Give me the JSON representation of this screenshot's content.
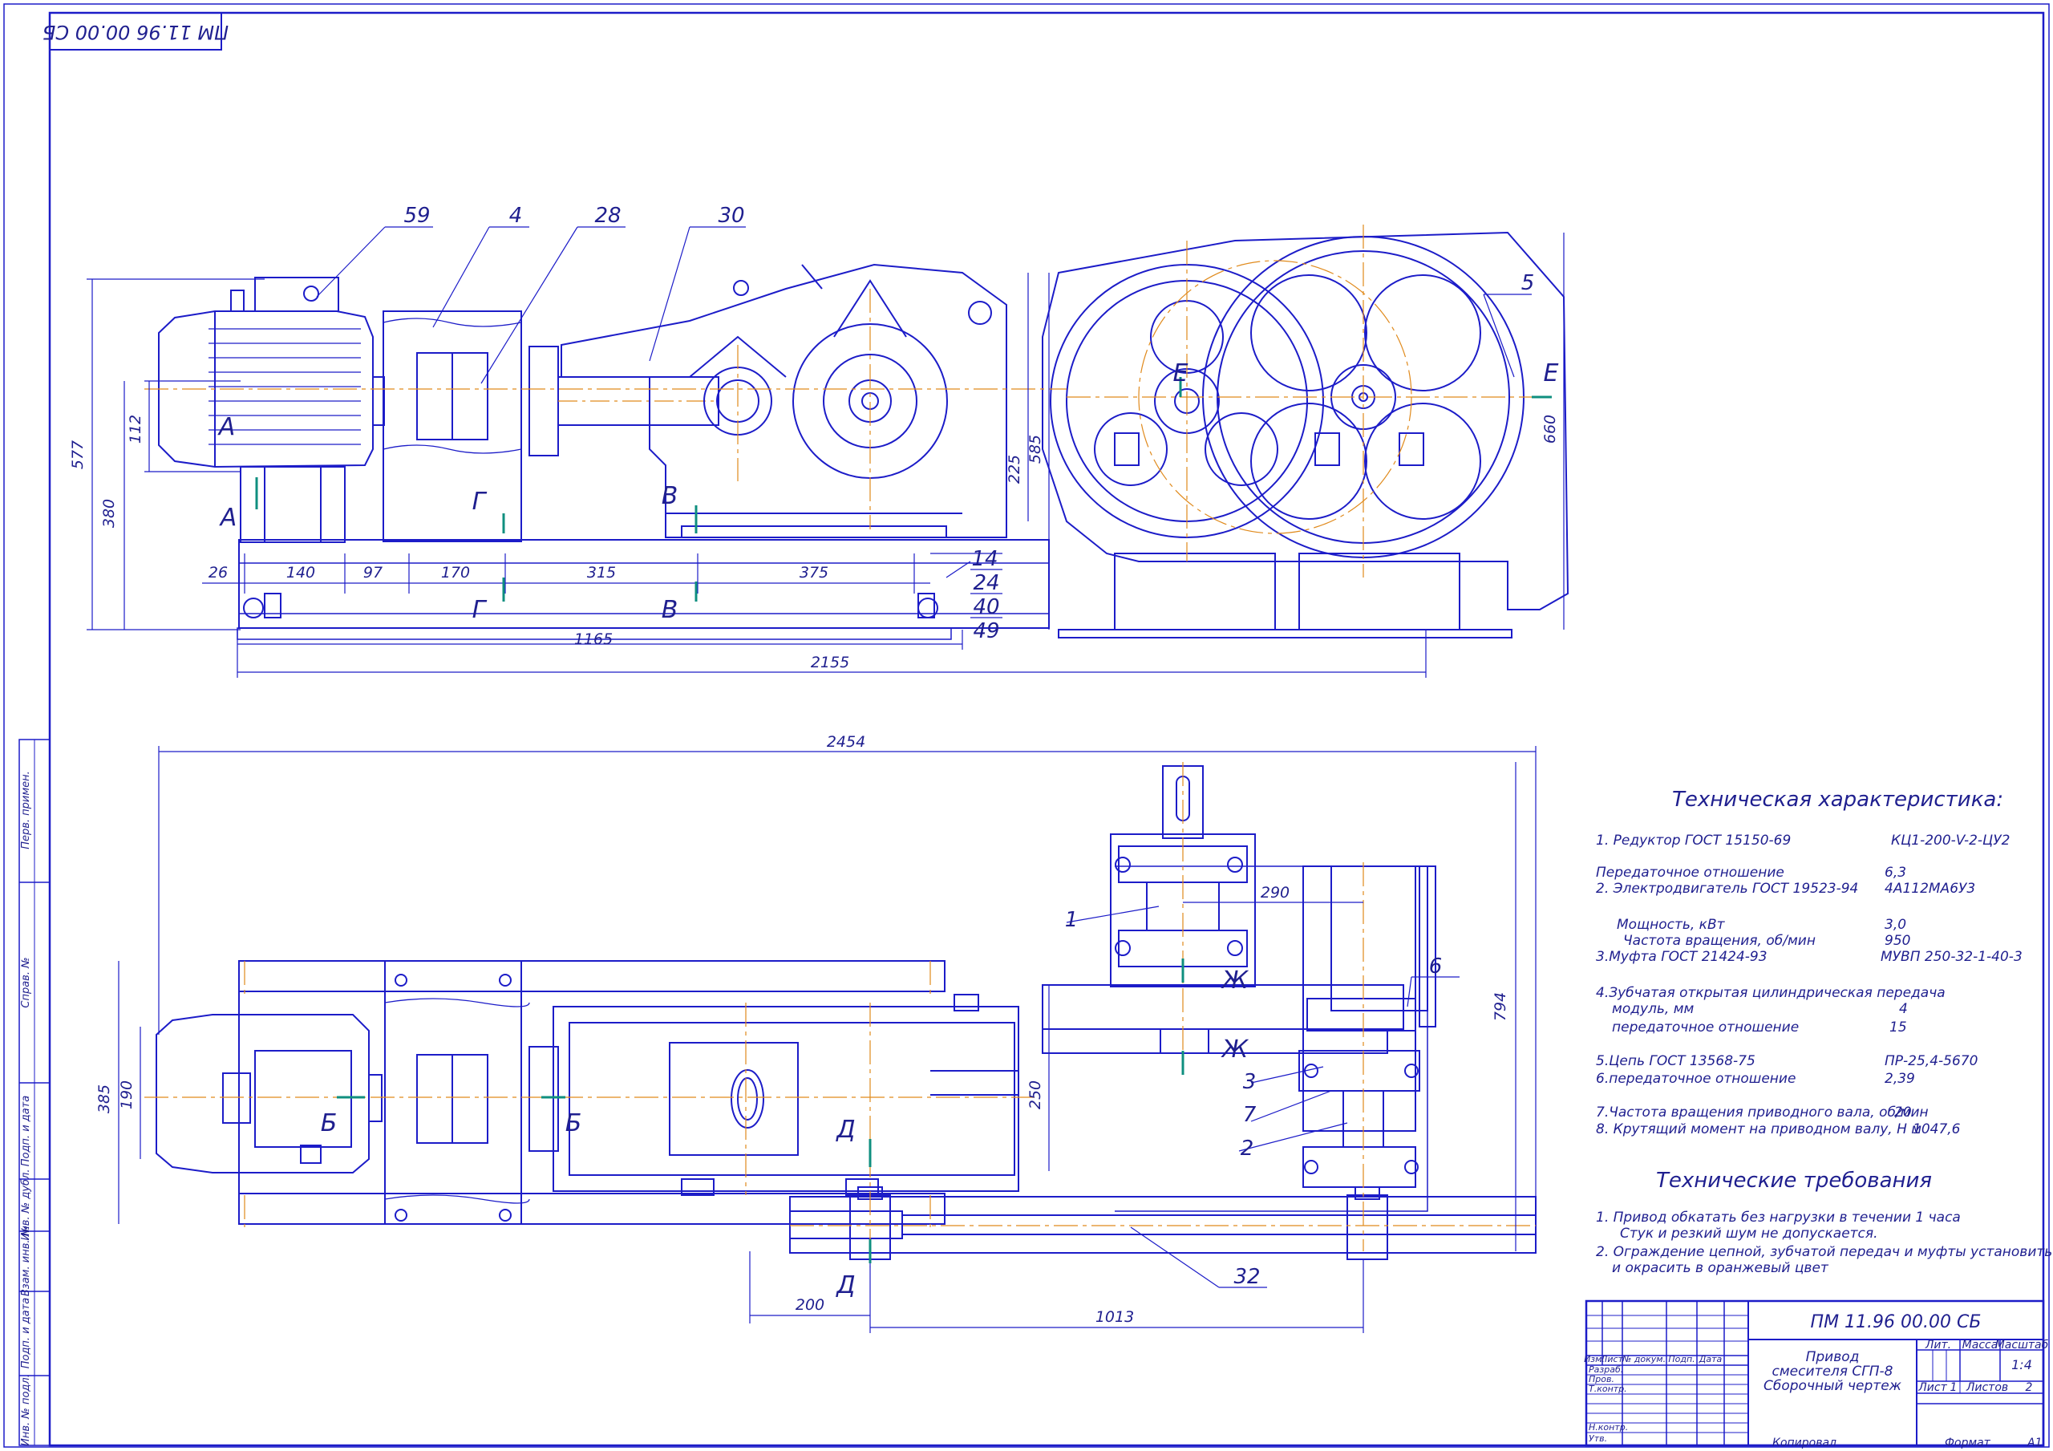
{
  "drawing": {
    "doc_code": "ПМ 11.96 00.00 СБ",
    "stamp_code_rotated": "ПМ 11.96 00.00 СБ",
    "title_lines": [
      "Привод",
      "смесителя СГП-8",
      "Сборочный чертеж"
    ],
    "litera_label": "Лит.",
    "mass_label": "Масса",
    "scale_label": "Масштаб",
    "scale_value": "1:4",
    "sheet_label": "Лист",
    "sheet_value": "1",
    "sheets_label": "Листов",
    "sheets_value": "2",
    "copied_label": "Копировал",
    "format_label": "Формат",
    "format_value": "А1",
    "change_cols": [
      "Изм.",
      "Лист",
      "№ докум.",
      "Подп.",
      "Дата"
    ],
    "roles": [
      "Разраб.",
      "Пров.",
      "Т.контр.",
      "",
      "Н.контр.",
      "Утв."
    ]
  },
  "side_stamp": [
    "Перв. примен.",
    "Справ. №",
    "Подп. и дата",
    "Инв. № дубл.",
    "Взам. инв. №",
    "Подп. и дата",
    "Инв. № подл."
  ],
  "parts": {
    "p59": "59",
    "p4": "4",
    "p28": "28",
    "p30": "30",
    "p5": "5",
    "p14": "14",
    "p24": "24",
    "p40": "40",
    "p49": "49",
    "p1": "1",
    "p6": "6",
    "p3": "3",
    "p7": "7",
    "p2": "2",
    "p32": "32"
  },
  "sections": {
    "A": "А",
    "B": "Б",
    "V": "В",
    "G": "Г",
    "D": "Д",
    "E": "Е",
    "Zh": "Ж"
  },
  "dims": {
    "d577": "577",
    "d380": "380",
    "d112": "112",
    "d225": "225",
    "d585": "585",
    "d660": "660",
    "d26": "26",
    "d140": "140",
    "d97": "97",
    "d170": "170",
    "d315": "315",
    "d375": "375",
    "d1165": "1165",
    "d2155": "2155",
    "d2454": "2454",
    "d290": "290",
    "d794": "794",
    "d385": "385",
    "d190": "190",
    "d250": "250",
    "d200": "200",
    "d1013": "1013"
  },
  "tech_specs": {
    "title": "Техническая характеристика:",
    "rows": [
      {
        "label": "1. Редуктор ГОСТ 15150-69",
        "value": "КЦ1-200-V-2-ЦУ2"
      },
      {
        "label": "Передаточное отношение",
        "value": "6,3"
      },
      {
        "label": "2. Электродвигатель ГОСТ 19523-94",
        "value": "4А112МА6У3"
      },
      {
        "label": "Мощность, кВт",
        "value": "3,0"
      },
      {
        "label": "Частота вращения, об/мин",
        "value": "950"
      },
      {
        "label": "3.Муфта ГОСТ 21424-93",
        "value": "МУВП 250-32-1-40-3"
      },
      {
        "label": "4.Зубчатая открытая цилиндрическая передача",
        "value": ""
      },
      {
        "label": "модуль, мм",
        "value": "4"
      },
      {
        "label": "передаточное отношение",
        "value": "15"
      },
      {
        "label": "5.Цепь ГОСТ 13568-75",
        "value": "ПР-25,4-5670"
      },
      {
        "label": "6.передаточное отношение",
        "value": "2,39"
      },
      {
        "label": "7.Частота вращения приводного вала, об/мин",
        "value": "20"
      },
      {
        "label": "8. Крутящий момент на приводном валу, Н м",
        "value": "1047,6"
      }
    ]
  },
  "tech_reqs": {
    "title": "Технические требования",
    "lines": [
      "1. Привод обкатать без нагрузки в течении        1 часа",
      "Стук и резкий шум не допускается.",
      "2. Ограждение цепной, зубчатой передач и муфты установить",
      "и окрасить в оранжевый цвет"
    ]
  },
  "colors": {
    "line": "#1c1cc8",
    "axis": "#e08a1c",
    "section_mark": "#0f8f7f",
    "text": "#1f1f8f"
  }
}
